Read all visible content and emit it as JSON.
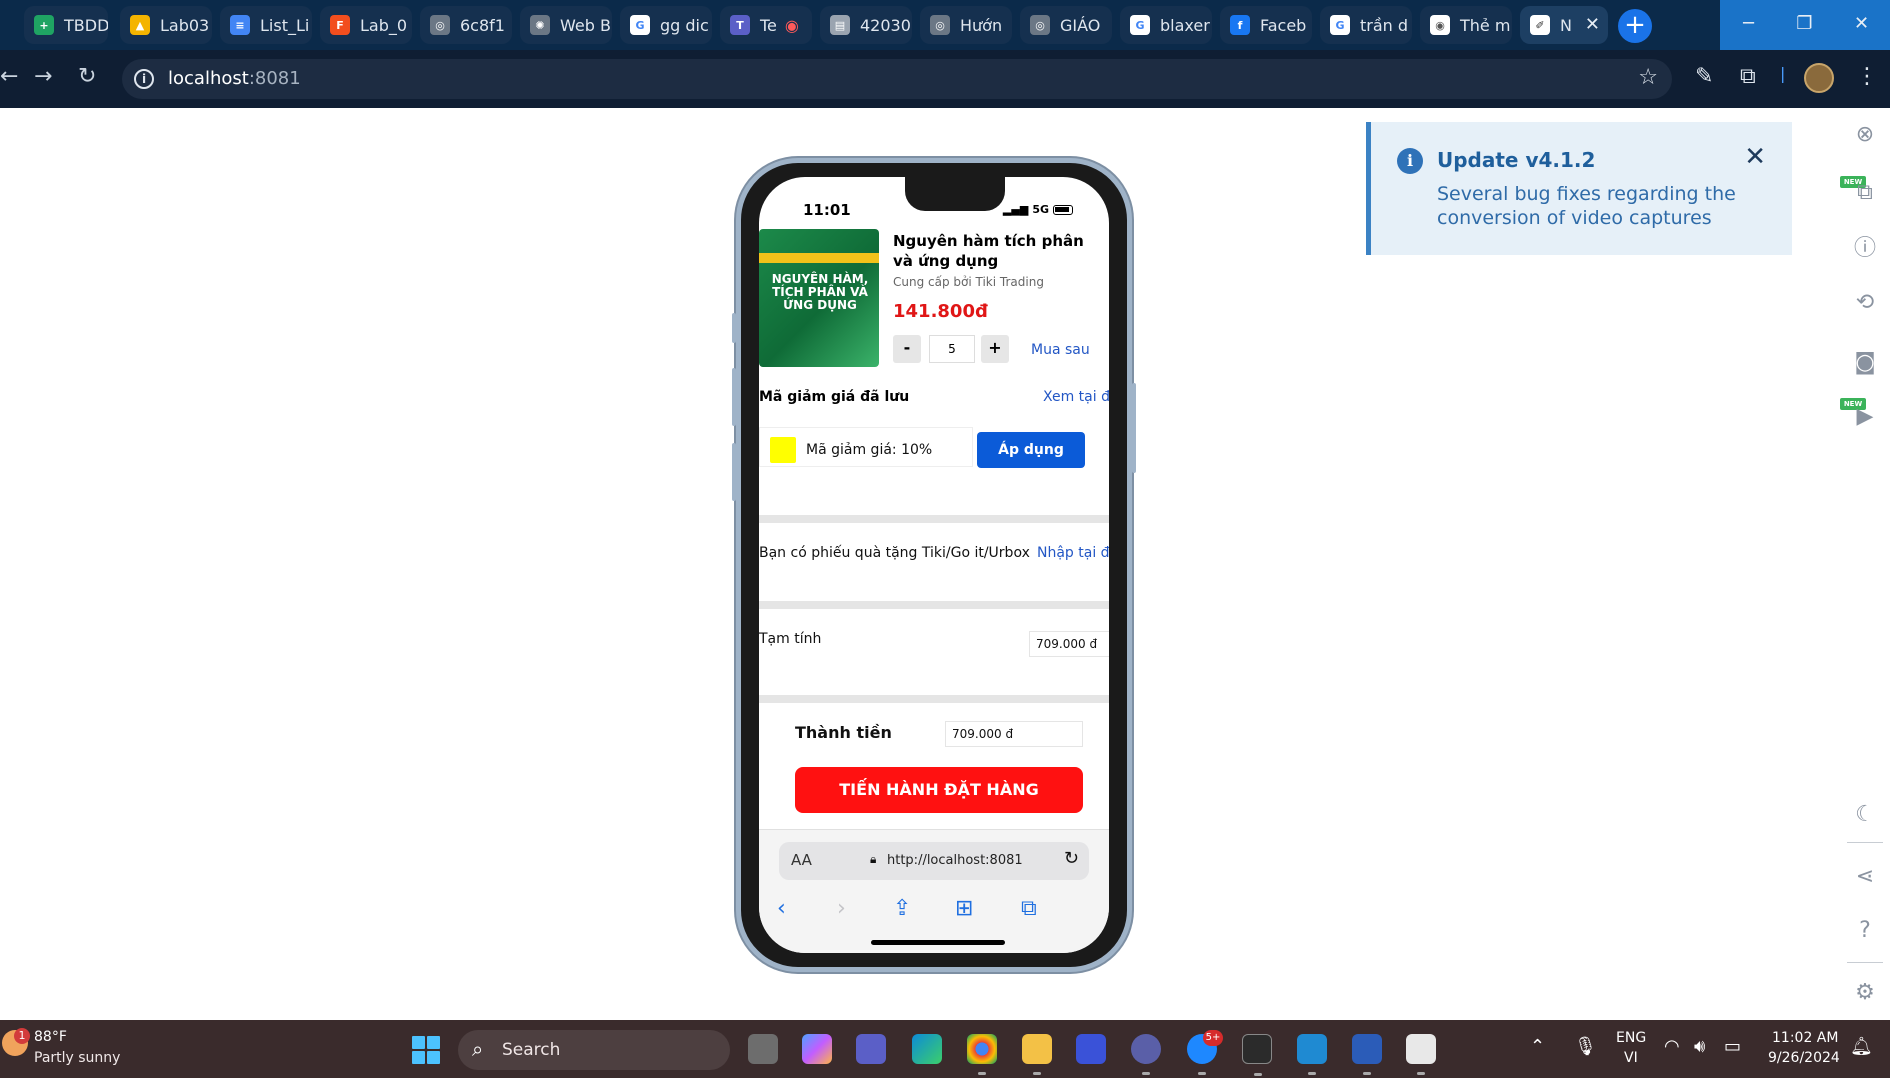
{
  "browser": {
    "tabs": [
      {
        "label": "TBDD",
        "icon": "sheets-icon",
        "color": "#1fa463"
      },
      {
        "label": "Lab03",
        "icon": "drive-icon",
        "color": "#f4b400"
      },
      {
        "label": "List_Li",
        "icon": "docs-icon",
        "color": "#4285f4"
      },
      {
        "label": "Lab_0",
        "icon": "figma-icon",
        "color": "#f24e1e"
      },
      {
        "label": "6c8f1",
        "icon": "globe-icon",
        "color": "#6b7785"
      },
      {
        "label": "Web B",
        "icon": "chatgpt-icon",
        "color": "#6b7785"
      },
      {
        "label": "gg dic",
        "icon": "google-icon",
        "color": "#ffffff"
      },
      {
        "label": "Te",
        "icon": "teams-icon",
        "color": "#5b5fc7"
      },
      {
        "label": "42030",
        "icon": "doc-icon",
        "color": "#9aa4b0"
      },
      {
        "label": "Hướn",
        "icon": "globe-icon",
        "color": "#6b7785"
      },
      {
        "label": "GIÁO",
        "icon": "globe-icon",
        "color": "#6b7785"
      },
      {
        "label": "blaxer",
        "icon": "google-icon",
        "color": "#ffffff"
      },
      {
        "label": "Faceb",
        "icon": "facebook-icon",
        "color": "#1877f2"
      },
      {
        "label": "trần d",
        "icon": "google-icon",
        "color": "#ffffff"
      },
      {
        "label": "Thẻ m",
        "icon": "chrome-icon",
        "color": "#ffffff"
      },
      {
        "label": "N",
        "icon": "expo-icon",
        "color": "#ffffff"
      }
    ],
    "url_host": "localhost",
    "url_port": ":8081"
  },
  "phone": {
    "time": "11:01",
    "network": "5G",
    "product": {
      "cover_title": "NGUYÊN HÀM, TÍCH PHÂN VÀ ỨNG DỤNG",
      "name": "Nguyên hàm tích phân và ứng dụng",
      "seller": "Cung cấp bởi Tiki Trading",
      "price": "141.800đ",
      "minus": "-",
      "quantity": "5",
      "plus": "+",
      "buy_later": "Mua sau"
    },
    "coupon": {
      "section_label": "Mã giảm giá đã lưu",
      "view_link": "Xem tại đây",
      "text": "Mã giảm giá: 10%",
      "apply_label": "Áp dụng",
      "swatch_color": "#ffff00"
    },
    "gift": {
      "text": "Bạn có phiếu quà tặng Tiki/Go it/Urbox",
      "link": "Nhập tại đây"
    },
    "subtotal": {
      "label": "Tạm tính",
      "value": "709.000 đ"
    },
    "total": {
      "label": "Thành tiền",
      "value": "709.000 đ"
    },
    "order_button": "TIẾN HÀNH ĐẶT HÀNG",
    "safari": {
      "aa": "AA",
      "url": "http://localhost:8081"
    }
  },
  "toast": {
    "title": "Update v4.1.2",
    "body": "Several bug fixes regarding the conversion of video captures"
  },
  "rail": {
    "new_badge": "NEW"
  },
  "taskbar": {
    "temperature": "88°F",
    "weather": "Partly sunny",
    "weather_badge": "1",
    "search_placeholder": "Search",
    "zalo_badge": "5+",
    "lang_top": "ENG",
    "lang_bottom": "VI",
    "time": "11:02 AM",
    "date": "9/26/2024"
  }
}
